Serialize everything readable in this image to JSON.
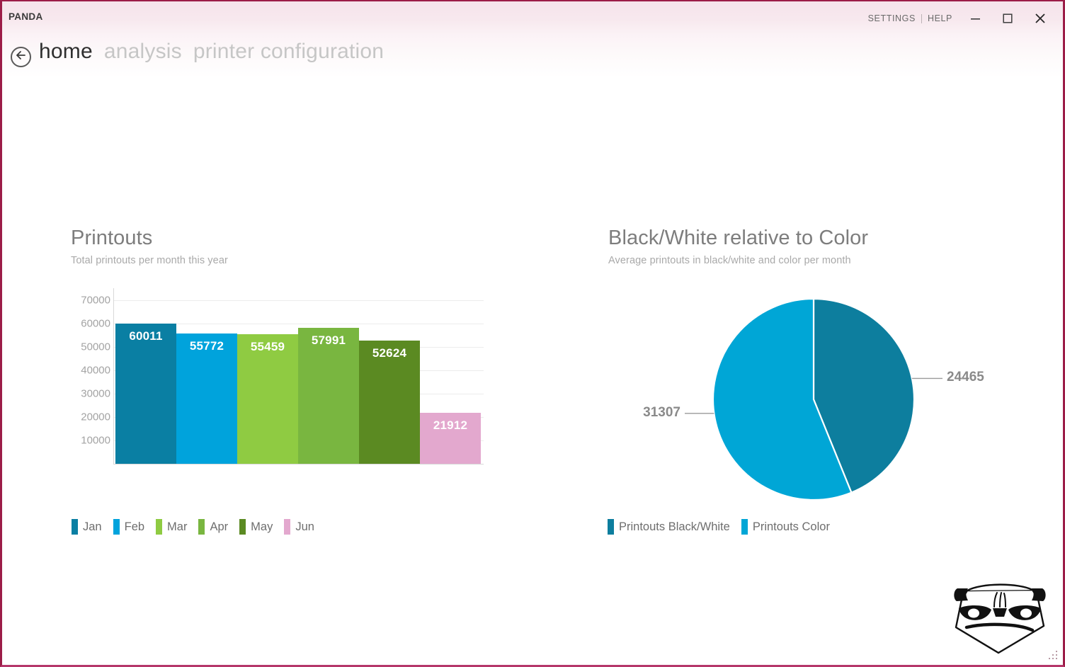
{
  "window": {
    "app_title": "PANDA",
    "border_color": "#9c1d48",
    "links": [
      {
        "label": "SETTINGS",
        "name": "settings-link"
      },
      {
        "label": "HELP",
        "name": "help-link"
      }
    ],
    "controls": [
      {
        "name": "minimize-button",
        "icon": "minimize-icon"
      },
      {
        "name": "maximize-button",
        "icon": "maximize-icon"
      },
      {
        "name": "close-button",
        "icon": "close-icon"
      }
    ]
  },
  "nav": {
    "back_icon": "back-arrow-icon",
    "crumbs": [
      {
        "label": "home",
        "active": true
      },
      {
        "label": "analysis",
        "active": false
      },
      {
        "label": "printer configuration",
        "active": false
      }
    ]
  },
  "bar_panel": {
    "title": "Printouts",
    "subtitle": "Total printouts per month this year"
  },
  "pie_panel": {
    "title": "Black/White relative to Color",
    "subtitle": "Average printouts in black/white and color per month"
  },
  "chart_data": [
    {
      "type": "bar",
      "title": "Printouts",
      "subtitle": "Total printouts per month this year",
      "xlabel": "",
      "ylabel": "",
      "categories": [
        "Jan",
        "Feb",
        "Mar",
        "Apr",
        "May",
        "Jun"
      ],
      "values": [
        60011,
        55772,
        55459,
        57991,
        52624,
        21912
      ],
      "colors": [
        "#0a7fa3",
        "#00a3dc",
        "#8fcb42",
        "#79b640",
        "#5b8a22",
        "#e3a8ce"
      ],
      "value_label_colors": [
        "#ffffff",
        "#ffffff",
        "#ffffff",
        "#ffffff",
        "#ffffff",
        "#ffffff"
      ],
      "ylim": [
        0,
        75000
      ],
      "yticks": [
        10000,
        20000,
        30000,
        40000,
        50000,
        60000,
        70000
      ],
      "ytick_labels": [
        "10000",
        "20000",
        "30000",
        "40000",
        "50000",
        "60000",
        "70000"
      ],
      "grid": true,
      "legend": "bottom",
      "legend_entries": [
        {
          "label": "Jan",
          "color": "#0a7fa3"
        },
        {
          "label": "Feb",
          "color": "#00a3dc"
        },
        {
          "label": "Mar",
          "color": "#8fcb42"
        },
        {
          "label": "Apr",
          "color": "#79b640"
        },
        {
          "label": "May",
          "color": "#5b8a22"
        },
        {
          "label": "Jun",
          "color": "#e3a8ce"
        }
      ]
    },
    {
      "type": "pie",
      "title": "Black/White relative to Color",
      "subtitle": "Average printouts in black/white and color per month",
      "labels": [
        "Printouts Black/White",
        "Printouts Color"
      ],
      "values": [
        24465,
        31307
      ],
      "value_labels": [
        "24465",
        "31307"
      ],
      "colors": [
        "#0d7e9e",
        "#00a6d6"
      ],
      "legend": "bottom",
      "legend_entries": [
        {
          "label": "Printouts Black/White",
          "color": "#0d7e9e"
        },
        {
          "label": "Printouts Color",
          "color": "#00a6d6"
        }
      ]
    }
  ]
}
